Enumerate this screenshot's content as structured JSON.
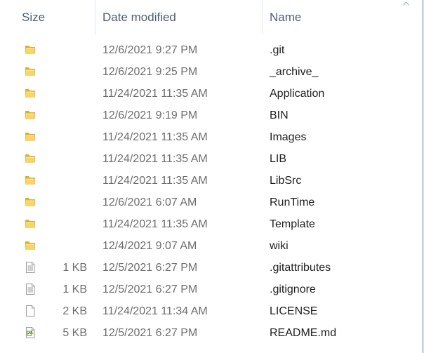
{
  "columns": {
    "size": "Size",
    "date_modified": "Date modified",
    "name": "Name"
  },
  "files": [
    {
      "icon": "folder-icon",
      "size": "",
      "date": "12/6/2021 9:27 PM",
      "name": ".git"
    },
    {
      "icon": "folder-icon",
      "size": "",
      "date": "12/6/2021 9:25 PM",
      "name": "_archive_"
    },
    {
      "icon": "folder-icon",
      "size": "",
      "date": "11/24/2021 11:35 AM",
      "name": "Application"
    },
    {
      "icon": "folder-icon",
      "size": "",
      "date": "12/6/2021 9:19 PM",
      "name": "BIN"
    },
    {
      "icon": "folder-icon",
      "size": "",
      "date": "11/24/2021 11:35 AM",
      "name": "Images"
    },
    {
      "icon": "folder-icon",
      "size": "",
      "date": "11/24/2021 11:35 AM",
      "name": "LIB"
    },
    {
      "icon": "folder-icon",
      "size": "",
      "date": "11/24/2021 11:35 AM",
      "name": "LibSrc"
    },
    {
      "icon": "folder-icon",
      "size": "",
      "date": "12/6/2021 6:07 AM",
      "name": "RunTime"
    },
    {
      "icon": "folder-icon",
      "size": "",
      "date": "11/24/2021 11:35 AM",
      "name": "Template"
    },
    {
      "icon": "folder-icon",
      "size": "",
      "date": "12/4/2021 9:07 AM",
      "name": "wiki"
    },
    {
      "icon": "text-file-icon",
      "size": "1 KB",
      "date": "12/5/2021 6:27 PM",
      "name": ".gitattributes"
    },
    {
      "icon": "text-file-icon",
      "size": "1 KB",
      "date": "12/5/2021 6:27 PM",
      "name": ".gitignore"
    },
    {
      "icon": "blank-file-icon",
      "size": "2 KB",
      "date": "11/24/2021 11:34 AM",
      "name": "LICENSE"
    },
    {
      "icon": "markdown-file-icon",
      "size": "5 KB",
      "date": "12/5/2021 6:27 PM",
      "name": "README.md"
    }
  ],
  "colors": {
    "header_text": "#4c607a",
    "secondary_text": "#6d6d6d",
    "name_text": "#1e1e1e",
    "folder": "#f0c040",
    "window_border": "#1f7fd1"
  }
}
